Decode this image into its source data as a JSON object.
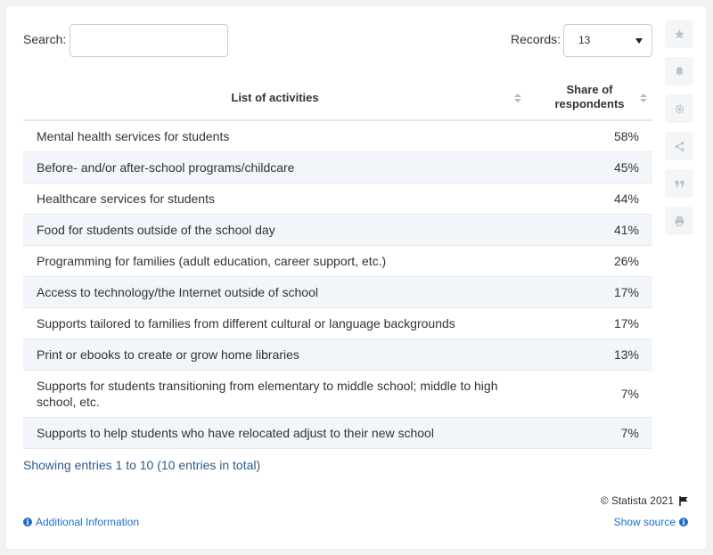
{
  "search": {
    "label": "Search:",
    "value": ""
  },
  "records": {
    "label": "Records:",
    "value": "13"
  },
  "tools": [
    "star-icon",
    "bell-icon",
    "gear-icon",
    "share-icon",
    "quote-icon",
    "print-icon"
  ],
  "chart_data": {
    "type": "table",
    "columns": [
      "List of activities",
      "Share of respondents"
    ],
    "rows": [
      {
        "activity": "Mental health services for students",
        "share": "58%"
      },
      {
        "activity": "Before- and/or after-school programs/childcare",
        "share": "45%"
      },
      {
        "activity": "Healthcare services for students",
        "share": "44%"
      },
      {
        "activity": "Food for students outside of the school day",
        "share": "41%"
      },
      {
        "activity": "Programming for families (adult education, career support, etc.)",
        "share": "26%"
      },
      {
        "activity": "Access to technology/the Internet outside of school",
        "share": "17%"
      },
      {
        "activity": "Supports tailored to families from different cultural or language backgrounds",
        "share": "17%"
      },
      {
        "activity": "Print or ebooks to create or grow home libraries",
        "share": "13%"
      },
      {
        "activity": "Supports for students transitioning from elementary to middle school; middle to high school, etc.",
        "share": "7%"
      },
      {
        "activity": "Supports to help students who have relocated adjust to their new school",
        "share": "7%"
      }
    ]
  },
  "footer": {
    "entries": "Showing entries 1 to 10 (10 entries in total)",
    "copyright": "© Statista 2021",
    "additional_info": "Additional Information",
    "show_source": "Show source"
  },
  "colors": {
    "link": "#1f6ec7",
    "stripe": "#f2f5f9",
    "tool_bg": "#f4f5f7"
  }
}
